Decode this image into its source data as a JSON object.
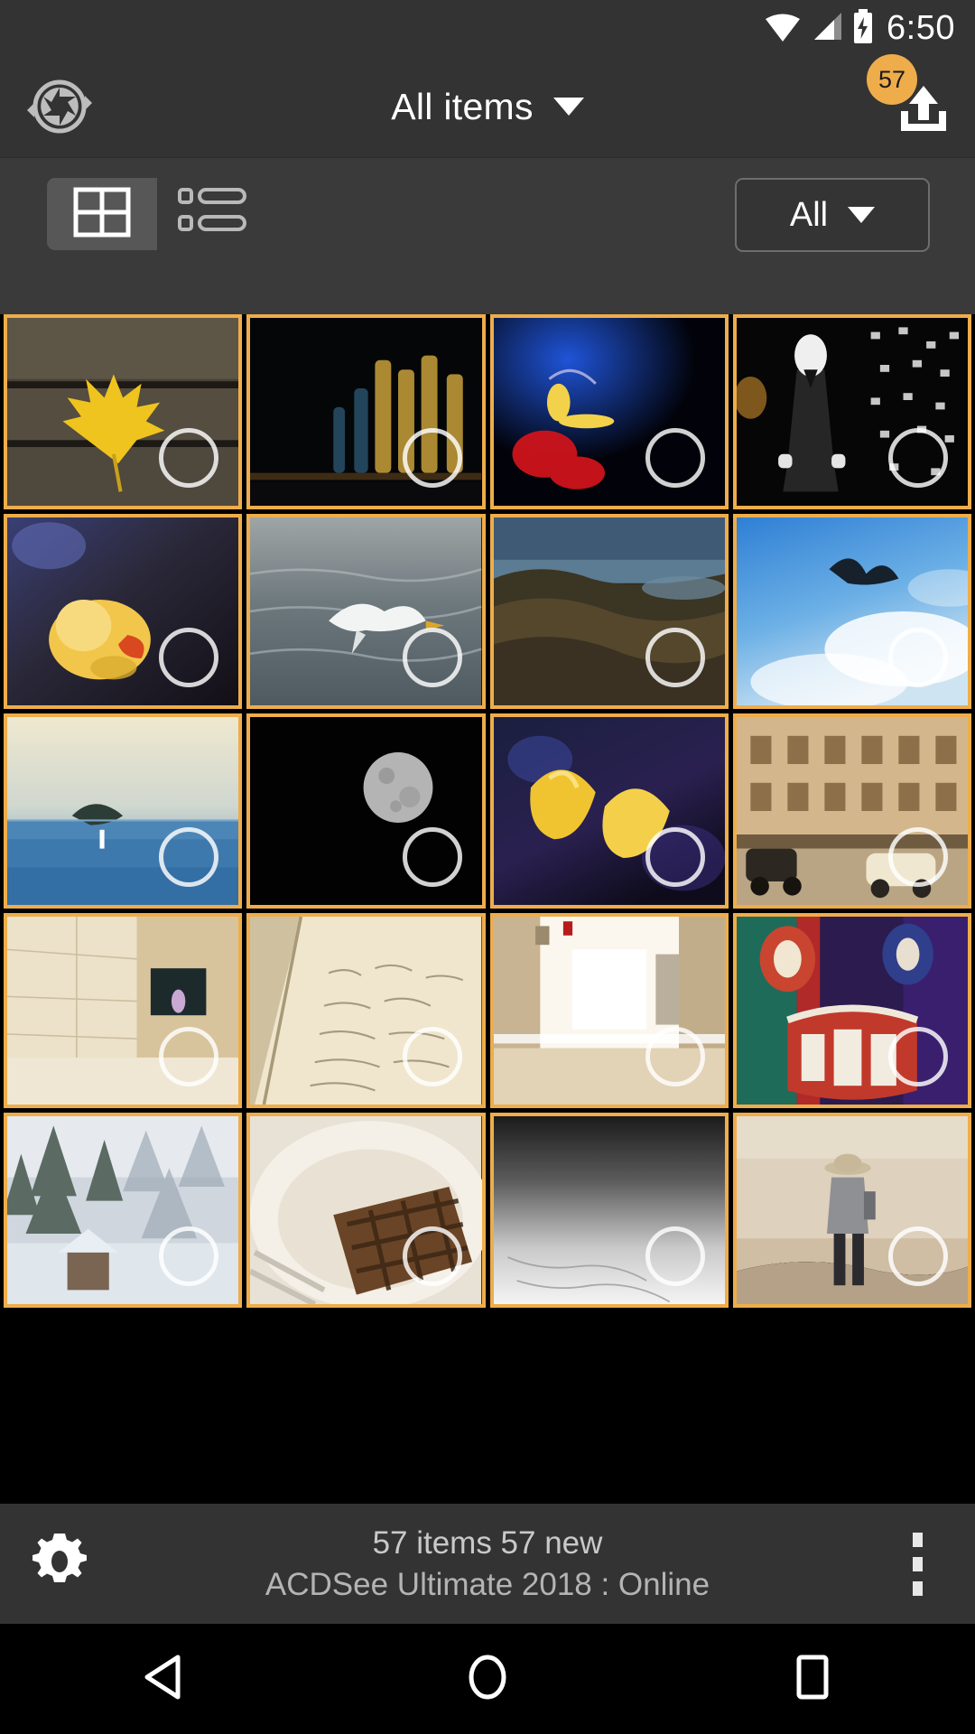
{
  "system_status_bar": {
    "time": "6:50",
    "icons": [
      "wifi-icon",
      "cell-signal-icon",
      "battery-charging-icon"
    ]
  },
  "app_bar": {
    "left_icon": "aperture-sync-icon",
    "title": "All items",
    "title_caret": "chevron-down-icon",
    "upload_icon": "upload-icon",
    "upload_badge_count": "57"
  },
  "sub_toolbar": {
    "view_toggle": {
      "grid_view": {
        "icon": "grid-view-icon",
        "selected": true
      },
      "list_view": {
        "icon": "list-view-icon",
        "selected": false
      }
    },
    "filter": {
      "label": "All",
      "caret": "chevron-down-icon"
    }
  },
  "colors": {
    "accent_orange": "#eead4a",
    "app_bar_bg": "#333333",
    "sub_toolbar_bg": "#3a3a3a",
    "grid_bg": "#000000",
    "nav_bar_bg": "#000000",
    "text_primary": "#ffffff",
    "text_secondary": "#c9c9c9"
  },
  "grid": {
    "columns": 4,
    "rows": 5,
    "selection_indicator": "unselected-circle-icon",
    "items": [
      {
        "name": "yellow-maple-leaf-on-wood",
        "selected": false
      },
      {
        "name": "wine-bottles-dark",
        "selected": false
      },
      {
        "name": "red-blue-light-painting",
        "selected": false
      },
      {
        "name": "man-in-suit-dark-lights",
        "selected": false
      },
      {
        "name": "yellow-tulip-closeup",
        "selected": false
      },
      {
        "name": "seagull-over-water",
        "selected": false
      },
      {
        "name": "rocky-coastline",
        "selected": false
      },
      {
        "name": "bird-flying-in-blue-sky",
        "selected": false
      },
      {
        "name": "small-island-on-sea",
        "selected": false
      },
      {
        "name": "full-moon-black-sky",
        "selected": false
      },
      {
        "name": "yellow-tulips-bokeh",
        "selected": false
      },
      {
        "name": "vintage-street-with-cars",
        "selected": false
      },
      {
        "name": "beige-interior-corridor",
        "selected": false
      },
      {
        "name": "open-notebook-handwriting",
        "selected": false
      },
      {
        "name": "bright-shopping-mall-hall",
        "selected": false
      },
      {
        "name": "colorful-totem-mask-art",
        "selected": false
      },
      {
        "name": "snowy-forest-cabin",
        "selected": false
      },
      {
        "name": "chocolate-cake-on-plate",
        "selected": false
      },
      {
        "name": "gradient-grey-snow-field",
        "selected": false
      },
      {
        "name": "person-standing-on-beach",
        "selected": false
      }
    ]
  },
  "bottom_bar": {
    "settings_icon": "gear-icon",
    "status_line_1": "57 items  57 new",
    "status_line_2": "ACDSee Ultimate 2018 : Online",
    "overflow_icon": "kebab-menu-icon"
  },
  "nav_bar": {
    "back": "back-triangle-icon",
    "home": "home-circle-icon",
    "recents": "recents-square-icon"
  }
}
